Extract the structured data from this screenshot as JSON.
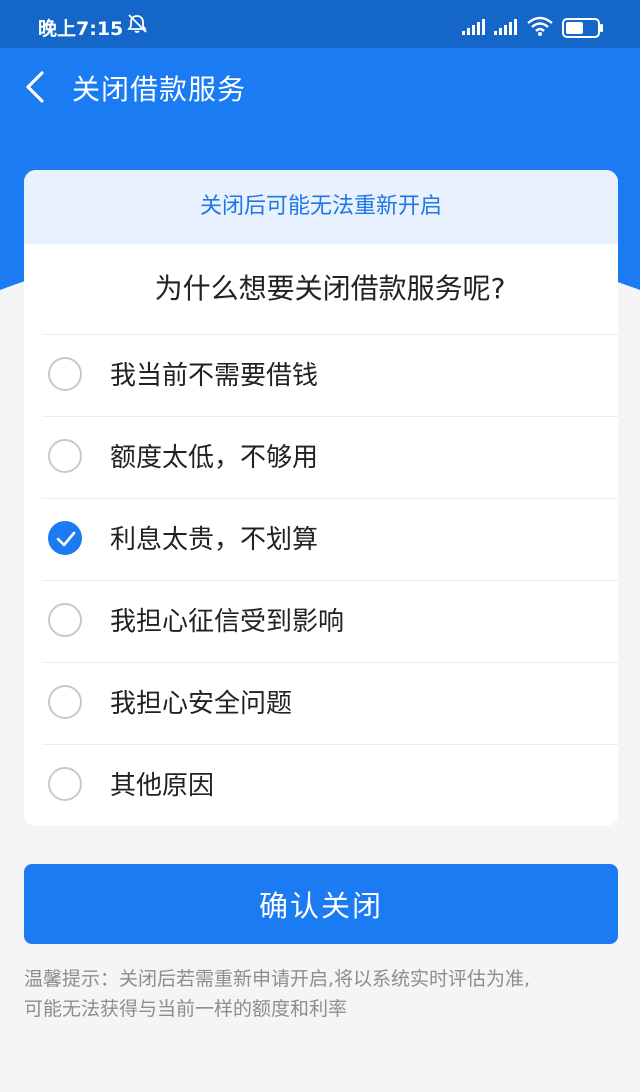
{
  "status_bar": {
    "time": "晚上7:15"
  },
  "header": {
    "title": "关闭借款服务"
  },
  "card": {
    "warning": "关闭后可能无法重新开启",
    "question": "为什么想要关闭借款服务呢?",
    "options": [
      {
        "label": "我当前不需要借钱",
        "checked": false
      },
      {
        "label": "额度太低，不够用",
        "checked": false
      },
      {
        "label": "利息太贵，不划算",
        "checked": true
      },
      {
        "label": "我担心征信受到影响",
        "checked": false
      },
      {
        "label": "我担心安全问题",
        "checked": false
      },
      {
        "label": "其他原因",
        "checked": false
      }
    ]
  },
  "confirm_button": "确认关闭",
  "tip": {
    "line1": "温馨提示：关闭后若需重新申请开启,将以系统实时评估为准,",
    "line2": "可能无法获得与当前一样的额度和利率"
  },
  "colors": {
    "primary": "#1a7bf2",
    "status_bar": "#1466c8",
    "banner_bg": "#e8f1fd",
    "banner_text": "#1f78e6"
  }
}
